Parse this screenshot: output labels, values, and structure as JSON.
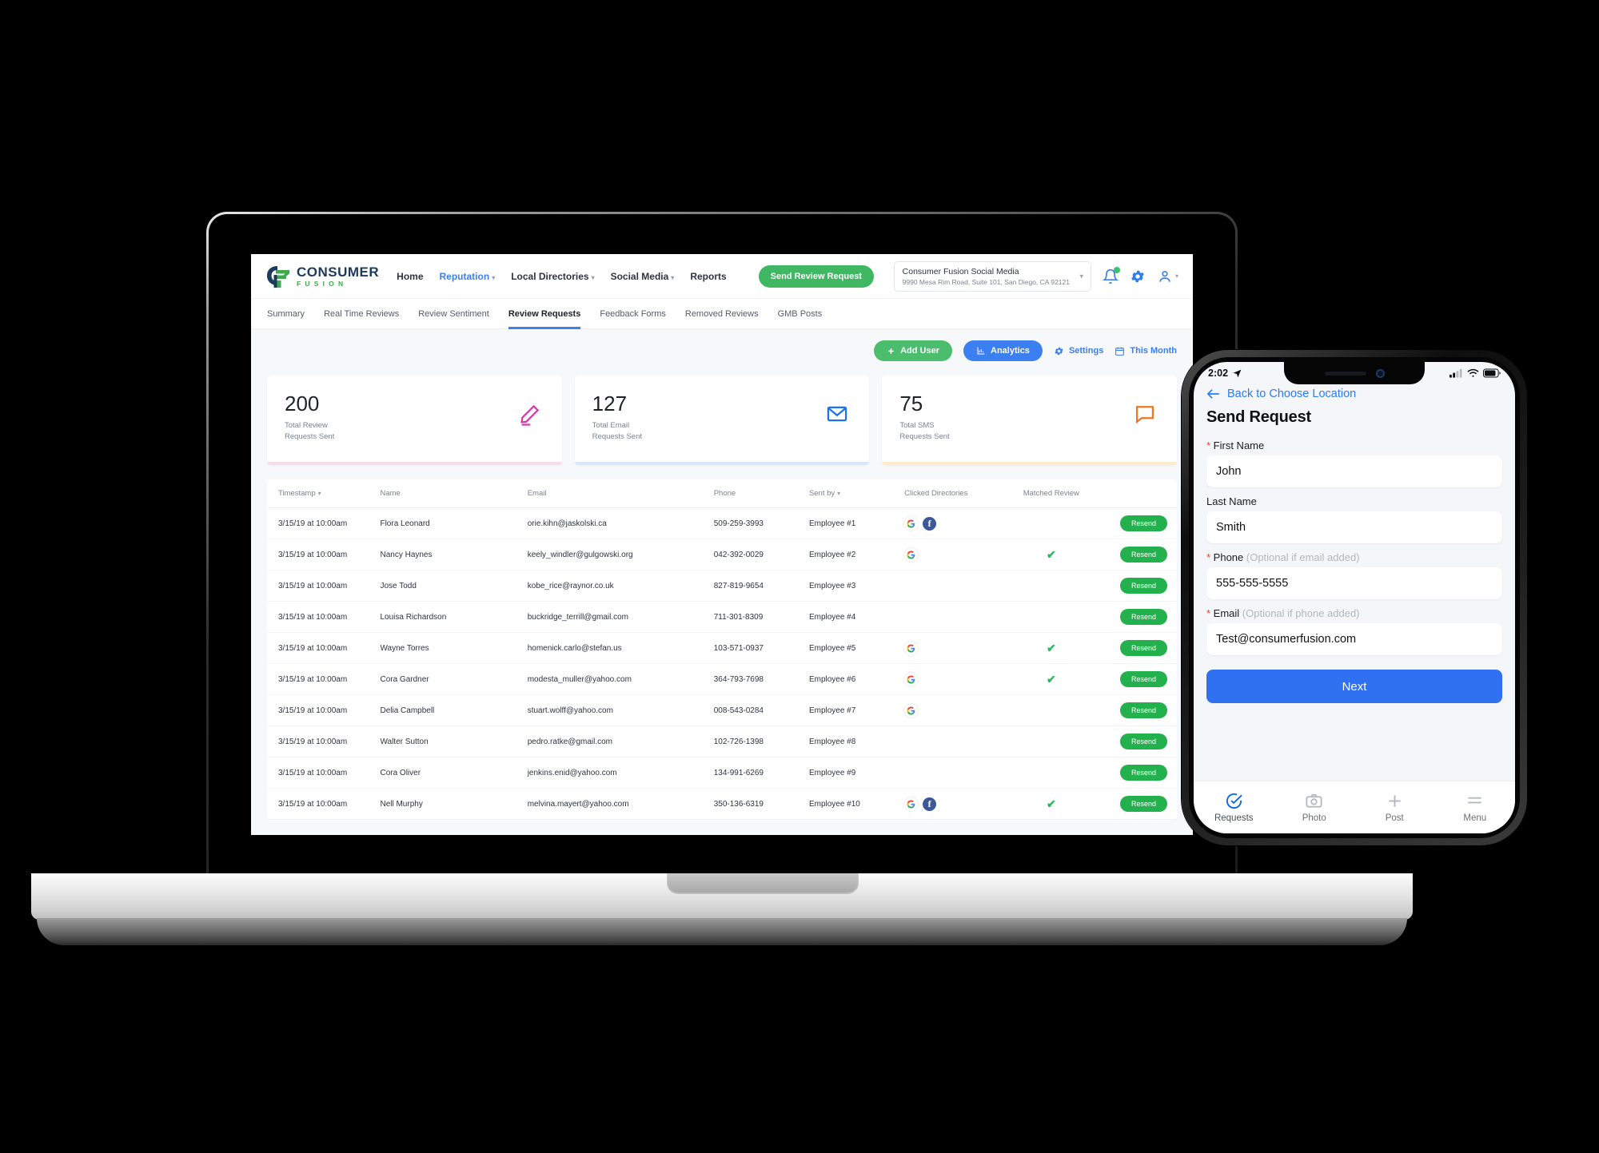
{
  "desktop": {
    "brand": {
      "name_top": "CONSUMER",
      "name_bottom": "FUSION"
    },
    "nav": [
      {
        "label": "Home",
        "has_caret": false,
        "active": false
      },
      {
        "label": "Reputation",
        "has_caret": true,
        "active": true
      },
      {
        "label": "Local Directories",
        "has_caret": true,
        "active": false
      },
      {
        "label": "Social Media",
        "has_caret": true,
        "active": false
      },
      {
        "label": "Reports",
        "has_caret": false,
        "active": false
      }
    ],
    "send_review_request_label": "Send Review Request",
    "location": {
      "name": "Consumer Fusion Social Media",
      "address": "9990 Mesa Rim Road, Suite 101, San Diego, CA 92121"
    },
    "icons": {
      "bell": "bell-icon",
      "gear": "gear-icon",
      "user": "user-icon"
    },
    "subnav": [
      {
        "label": "Summary",
        "active": false
      },
      {
        "label": "Real Time Reviews",
        "active": false
      },
      {
        "label": "Review Sentiment",
        "active": false
      },
      {
        "label": "Review Requests",
        "active": true
      },
      {
        "label": "Feedback Forms",
        "active": false
      },
      {
        "label": "Removed Reviews",
        "active": false
      },
      {
        "label": "GMB Posts",
        "active": false
      }
    ],
    "toolbar": {
      "add_user": "Add User",
      "analytics": "Analytics",
      "settings": "Settings",
      "date_range": "This Month"
    },
    "stat_cards": [
      {
        "value": "200",
        "label_line1": "Total Review",
        "label_line2": "Requests Sent",
        "icon": "pencil-icon",
        "color": "#d33ba8",
        "bar": "#f6dcec"
      },
      {
        "value": "127",
        "label_line1": "Total Email",
        "label_line2": "Requests Sent",
        "icon": "envelope-icon",
        "color": "#1a73f0",
        "bar": "#d9e7fb"
      },
      {
        "value": "75",
        "label_line1": "Total SMS",
        "label_line2": "Requests Sent",
        "icon": "chat-bubble-icon",
        "color": "#ee7722",
        "bar": "#fdeccf"
      }
    ],
    "table": {
      "columns": [
        "Timestamp",
        "Name",
        "Email",
        "Phone",
        "Sent by",
        "Clicked Directories",
        "Matched Review",
        ""
      ],
      "sortable": [
        true,
        false,
        false,
        false,
        true,
        false,
        false,
        false
      ],
      "action_label": "Resend",
      "rows": [
        {
          "timestamp": "3/15/19 at 10:00am",
          "name": "Flora Leonard",
          "email": "orie.kihn@jaskolski.ca",
          "phone": "509-259-3993",
          "sent_by": "Employee #1",
          "directories": [
            "google",
            "facebook"
          ],
          "matched": false
        },
        {
          "timestamp": "3/15/19 at 10:00am",
          "name": "Nancy Haynes",
          "email": "keely_windler@gulgowski.org",
          "phone": "042-392-0029",
          "sent_by": "Employee #2",
          "directories": [
            "google"
          ],
          "matched": true
        },
        {
          "timestamp": "3/15/19 at 10:00am",
          "name": "Jose Todd",
          "email": "kobe_rice@raynor.co.uk",
          "phone": "827-819-9654",
          "sent_by": "Employee #3",
          "directories": [],
          "matched": false
        },
        {
          "timestamp": "3/15/19 at 10:00am",
          "name": "Louisa Richardson",
          "email": "buckridge_terrill@gmail.com",
          "phone": "711-301-8309",
          "sent_by": "Employee #4",
          "directories": [],
          "matched": false
        },
        {
          "timestamp": "3/15/19 at 10:00am",
          "name": "Wayne Torres",
          "email": "homenick.carlo@stefan.us",
          "phone": "103-571-0937",
          "sent_by": "Employee #5",
          "directories": [
            "google"
          ],
          "matched": true
        },
        {
          "timestamp": "3/15/19 at 10:00am",
          "name": "Cora Gardner",
          "email": "modesta_muller@yahoo.com",
          "phone": "364-793-7698",
          "sent_by": "Employee #6",
          "directories": [
            "google"
          ],
          "matched": true
        },
        {
          "timestamp": "3/15/19 at 10:00am",
          "name": "Delia Campbell",
          "email": "stuart.wolff@yahoo.com",
          "phone": "008-543-0284",
          "sent_by": "Employee #7",
          "directories": [
            "google"
          ],
          "matched": false
        },
        {
          "timestamp": "3/15/19 at 10:00am",
          "name": "Walter Sutton",
          "email": "pedro.ratke@gmail.com",
          "phone": "102-726-1398",
          "sent_by": "Employee #8",
          "directories": [],
          "matched": false
        },
        {
          "timestamp": "3/15/19 at 10:00am",
          "name": "Cora Oliver",
          "email": "jenkins.enid@yahoo.com",
          "phone": "134-991-6269",
          "sent_by": "Employee #9",
          "directories": [],
          "matched": false
        },
        {
          "timestamp": "3/15/19 at 10:00am",
          "name": "Nell Murphy",
          "email": "melvina.mayert@yahoo.com",
          "phone": "350-136-6319",
          "sent_by": "Employee #10",
          "directories": [
            "google",
            "facebook"
          ],
          "matched": true
        }
      ]
    }
  },
  "phone": {
    "status": {
      "time": "2:02",
      "location_arrow": "location-arrow-icon"
    },
    "back_label": "Back to Choose Location",
    "screen_title": "Send Request",
    "fields": [
      {
        "label": "First Name",
        "required": true,
        "hint": "",
        "value": "John"
      },
      {
        "label": "Last Name",
        "required": false,
        "hint": "",
        "value": "Smith"
      },
      {
        "label": "Phone",
        "required": true,
        "hint": "(Optional if email added)",
        "value": "555-555-5555"
      },
      {
        "label": "Email",
        "required": true,
        "hint": "(Optional if phone added)",
        "value": "Test@consumerfusion.com"
      }
    ],
    "next_label": "Next",
    "tabs": [
      {
        "label": "Requests",
        "icon": "check-circle-icon",
        "active": true
      },
      {
        "label": "Photo",
        "icon": "camera-icon",
        "active": false
      },
      {
        "label": "Post",
        "icon": "plus-icon",
        "active": false
      },
      {
        "label": "Menu",
        "icon": "hamburger-icon",
        "active": false
      }
    ]
  }
}
